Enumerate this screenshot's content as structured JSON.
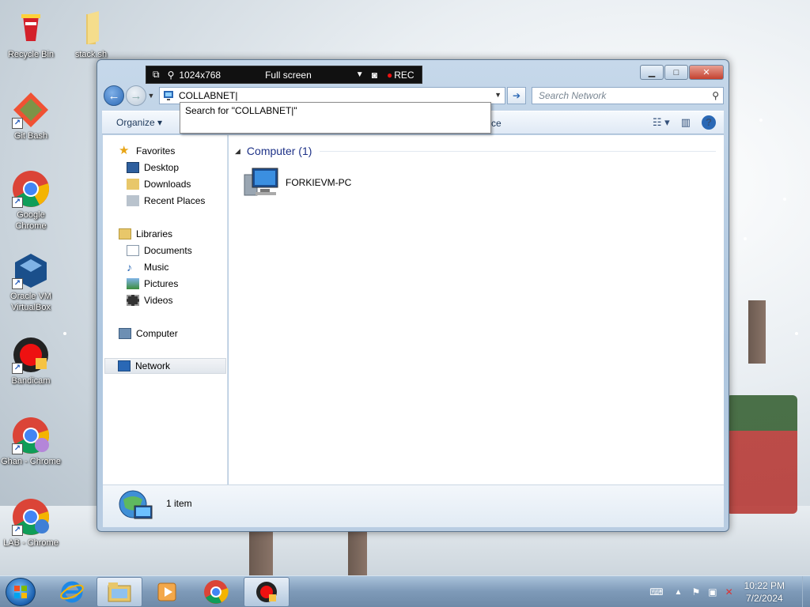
{
  "desktop": {
    "icons": [
      {
        "label": "Recycle Bin"
      },
      {
        "label": "stack.sh"
      },
      {
        "label": "Git Bash"
      },
      {
        "label": "Google Chrome"
      },
      {
        "label": "Oracle VM VirtualBox"
      },
      {
        "label": "Bandicam"
      },
      {
        "label": "Ghan - Chrome"
      },
      {
        "label": "LAB - Chrome"
      }
    ]
  },
  "recorder": {
    "resolution": "1024x768",
    "mode": "Full screen",
    "rec_label": "REC"
  },
  "explorer": {
    "address_value": "COLLABNET|",
    "search_placeholder": "Search Network",
    "suggestion": "Search for \"COLLABNET|\"",
    "toolbar": {
      "organize": "Organize",
      "obscured_tail": "ce"
    },
    "nav": {
      "favorites": "Favorites",
      "desktop": "Desktop",
      "downloads": "Downloads",
      "recent": "Recent Places",
      "libraries": "Libraries",
      "documents": "Documents",
      "music": "Music",
      "pictures": "Pictures",
      "videos": "Videos",
      "computer": "Computer",
      "network": "Network"
    },
    "group_header": "Computer (1)",
    "items": [
      {
        "label": "FORKIEVM-PC"
      }
    ],
    "status": "1 item"
  },
  "taskbar": {
    "time": "10:22 PM",
    "date": "7/2/2024"
  },
  "colors": {
    "accent": "#2a68b5",
    "group_header": "#1e3287"
  }
}
